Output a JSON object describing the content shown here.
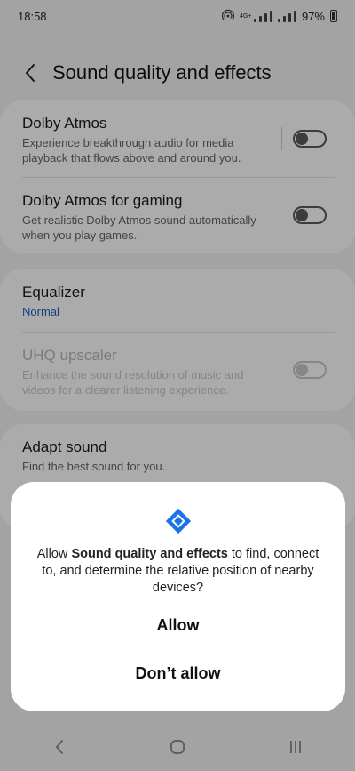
{
  "status_bar": {
    "time": "18:58",
    "network": "4G+",
    "battery_text": "97%"
  },
  "header": {
    "title": "Sound quality and effects"
  },
  "settings": {
    "dolby_atmos": {
      "title": "Dolby Atmos",
      "description": "Experience breakthrough audio for media playback that flows above and around you.",
      "enabled": false
    },
    "dolby_gaming": {
      "title": "Dolby Atmos for gaming",
      "description": "Get realistic Dolby Atmos sound automatically when you play games.",
      "enabled": false
    },
    "equalizer": {
      "title": "Equalizer",
      "value": "Normal"
    },
    "uhq": {
      "title": "UHQ upscaler",
      "description": "Enhance the sound resolution of music and videos for a clearer listening experience.",
      "enabled": false,
      "disabled": true
    },
    "adapt_sound": {
      "title": "Adapt sound",
      "description": "Find the best sound for you."
    }
  },
  "dialog": {
    "message_prefix": "Allow ",
    "app_name": "Sound quality and effects",
    "message_suffix": " to find, connect to, and determine the relative position of nearby devices?",
    "allow_label": "Allow",
    "deny_label": "Don’t allow",
    "icon": "nearby-devices-icon",
    "accent_color": "#1a73e8"
  },
  "colors": {
    "link": "#1a5fc4",
    "background": "#f4f4f4"
  }
}
